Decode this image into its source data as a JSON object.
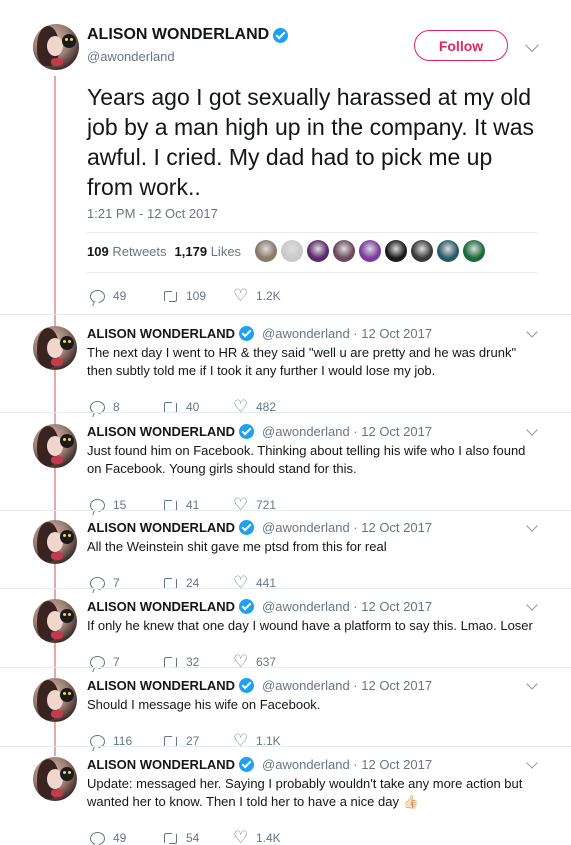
{
  "main_tweet": {
    "name": "ALISON WONDERLAND",
    "handle": "@awonderland",
    "follow_label": "Follow",
    "text": "Years ago I got sexually harassed at my old job by a man high up in the company. It was awful. I cried. My dad had to pick me up from work..",
    "timestamp": "1:21 PM - 12 Oct 2017",
    "retweets_count": "109",
    "retweets_label": "Retweets",
    "likes_count": "1,179",
    "likes_label": "Likes",
    "actions": {
      "replies": "49",
      "retweets": "109",
      "likes": "1.2K"
    },
    "liker_colors": [
      "#8a7a6a",
      "#c9c9c9",
      "#5a2a6a",
      "#6b4a5a",
      "#7a3aa0",
      "#1a1a1a",
      "#3a3a3a",
      "#2a5a6a",
      "#1a6a3a"
    ]
  },
  "replies": [
    {
      "name": "ALISON WONDERLAND",
      "handle": "@awonderland · 12 Oct 2017",
      "text": "The next day I went to HR & they said \"well u are pretty and he was drunk\" then subtly told me if I took it any further I would lose my job.",
      "replies": "8",
      "retweets": "40",
      "likes": "482"
    },
    {
      "name": "ALISON WONDERLAND",
      "handle": "@awonderland · 12 Oct 2017",
      "text": "Just found him on Facebook. Thinking about telling his wife who I also found on Facebook. Young girls should stand for this.",
      "replies": "15",
      "retweets": "41",
      "likes": "721"
    },
    {
      "name": "ALISON WONDERLAND",
      "handle": "@awonderland · 12 Oct 2017",
      "text": "All the Weinstein shit gave me ptsd from this for real",
      "replies": "7",
      "retweets": "24",
      "likes": "441"
    },
    {
      "name": "ALISON WONDERLAND",
      "handle": "@awonderland · 12 Oct 2017",
      "text": "If only he knew that one day I wound have a platform to say this. Lmao. Loser",
      "replies": "7",
      "retweets": "32",
      "likes": "637"
    },
    {
      "name": "ALISON WONDERLAND",
      "handle": "@awonderland · 12 Oct 2017",
      "text": "Should I message his wife on Facebook.",
      "replies": "116",
      "retweets": "27",
      "likes": "1.1K"
    },
    {
      "name": "ALISON WONDERLAND",
      "handle": "@awonderland · 12 Oct 2017",
      "text": "Update: messaged her. Saying I probably wouldn't take any more action but wanted her to know. Then I told her to have a nice day 👍🏻",
      "replies": "49",
      "retweets": "54",
      "likes": "1.4K"
    }
  ],
  "colors": {
    "verified": "#1da1f2",
    "follow": "#e0245e",
    "thread_line": "#e5a9a9",
    "muted": "#657786"
  }
}
